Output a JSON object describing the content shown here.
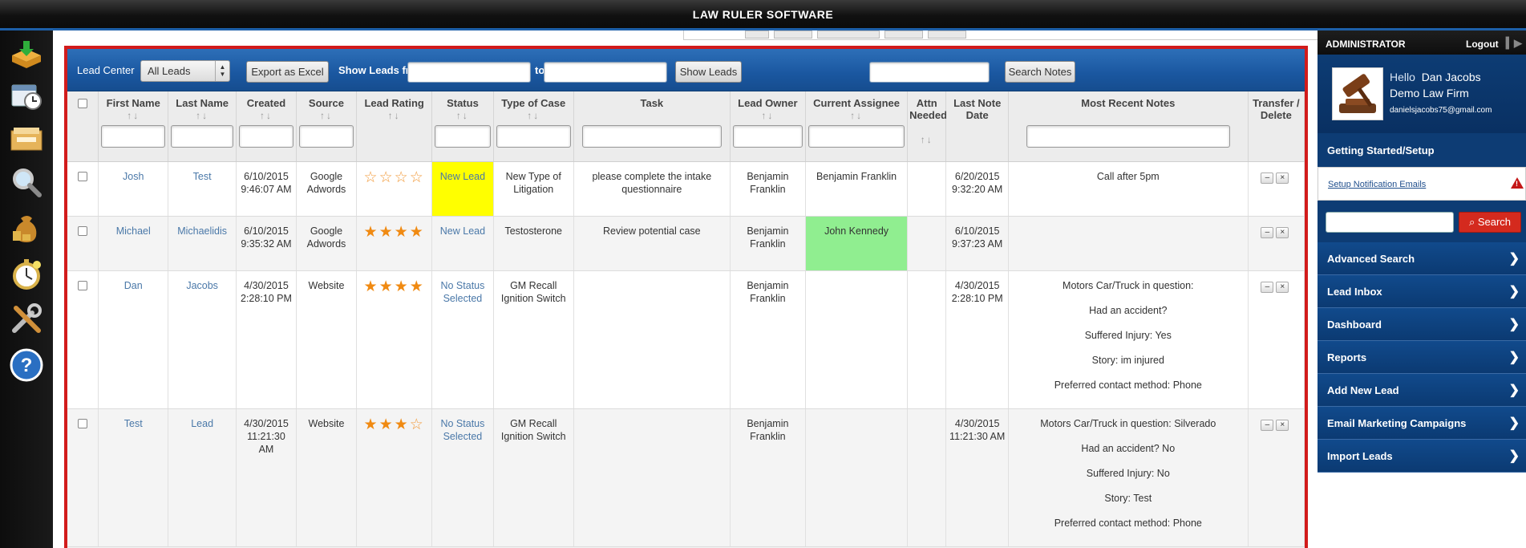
{
  "app": {
    "title": "LAW RULER SOFTWARE"
  },
  "left_rail": {
    "icons": [
      "leads-inbox-icon",
      "calendar-clock-icon",
      "reports-folder-icon",
      "search-magnifier-icon",
      "money-bags-icon",
      "stopwatch-icon",
      "tools-icon",
      "help-icon"
    ]
  },
  "toolbar": {
    "lead_center_label": "Lead Center",
    "lead_filter_value": "All Leads",
    "export_label": "Export as Excel",
    "show_from_label": "Show Leads from",
    "to_label": "to",
    "show_leads_label": "Show Leads",
    "search_notes_label": "Search Notes"
  },
  "table": {
    "columns": [
      "First Name",
      "Last Name",
      "Created",
      "Source",
      "Lead Rating",
      "Status",
      "Type of Case",
      "Task",
      "Lead Owner",
      "Current Assignee",
      "Attn Needed",
      "Last Note Date",
      "Most Recent Notes",
      "Transfer / Delete"
    ],
    "rows": [
      {
        "first": "Josh",
        "last": "Test",
        "created": "6/10/2015 9:46:07 AM",
        "source": "Google Adwords",
        "rating": 0,
        "status": "New Lead",
        "type": "New Type of Litigation",
        "task": "please complete the intake questionnaire",
        "owner": "Benjamin Franklin",
        "assignee": "Benjamin Franklin",
        "attn": "",
        "last_note": "6/20/2015 9:32:20 AM",
        "notes": [
          "Call after 5pm"
        ]
      },
      {
        "first": "Michael",
        "last": "Michaelidis",
        "created": "6/10/2015 9:35:32 AM",
        "source": "Google Adwords",
        "rating": 4,
        "status": "New Lead",
        "type": "Testosterone",
        "task": "Review potential case",
        "owner": "Benjamin Franklin",
        "assignee": "John Kennedy",
        "attn": "",
        "last_note": "6/10/2015 9:37:23 AM",
        "notes": []
      },
      {
        "first": "Dan",
        "last": "Jacobs",
        "created": "4/30/2015 2:28:10 PM",
        "source": "Website",
        "rating": 4,
        "status": "No Status Selected",
        "type": "GM Recall Ignition Switch",
        "task": "",
        "owner": "Benjamin Franklin",
        "assignee": "",
        "attn": "",
        "last_note": "4/30/2015 2:28:10 PM",
        "notes": [
          "Motors Car/Truck in question:",
          "Had an accident?",
          "Suffered Injury: Yes",
          "Story: im injured",
          "Preferred contact method: Phone"
        ]
      },
      {
        "first": "Test",
        "last": "Lead",
        "created": "4/30/2015 11:21:30 AM",
        "source": "Website",
        "rating": 3,
        "status": "No Status Selected",
        "type": "GM Recall Ignition Switch",
        "task": "",
        "owner": "Benjamin Franklin",
        "assignee": "",
        "attn": "",
        "last_note": "4/30/2015 11:21:30 AM",
        "notes": [
          "Motors Car/Truck in question: Silverado",
          "Had an accident? No",
          "Suffered Injury: No",
          "Story: Test",
          "Preferred contact method: Phone"
        ]
      }
    ],
    "row_actions": {
      "minimize": "–",
      "delete": "×"
    }
  },
  "colors": {
    "status_new_highlight": "#ffff00",
    "assignee_highlight": "#90ee90",
    "star": "#f08a12",
    "frame_border": "#d21b1b",
    "toolbar_blue": "#1a57a0"
  },
  "right_panel": {
    "admin_label": "ADMINISTRATOR",
    "logout_label": "Logout",
    "hello": "Hello",
    "user_name": "Dan Jacobs",
    "firm": "Demo Law Firm",
    "email": "danielsjacobs75@gmail.com",
    "getting_started": "Getting Started/Setup",
    "setup_link": "Setup Notification Emails",
    "search_button": "Search",
    "menu": [
      "Advanced Search",
      "Lead Inbox",
      "Dashboard",
      "Reports",
      "Add New Lead",
      "Email Marketing Campaigns",
      "Import Leads"
    ]
  }
}
